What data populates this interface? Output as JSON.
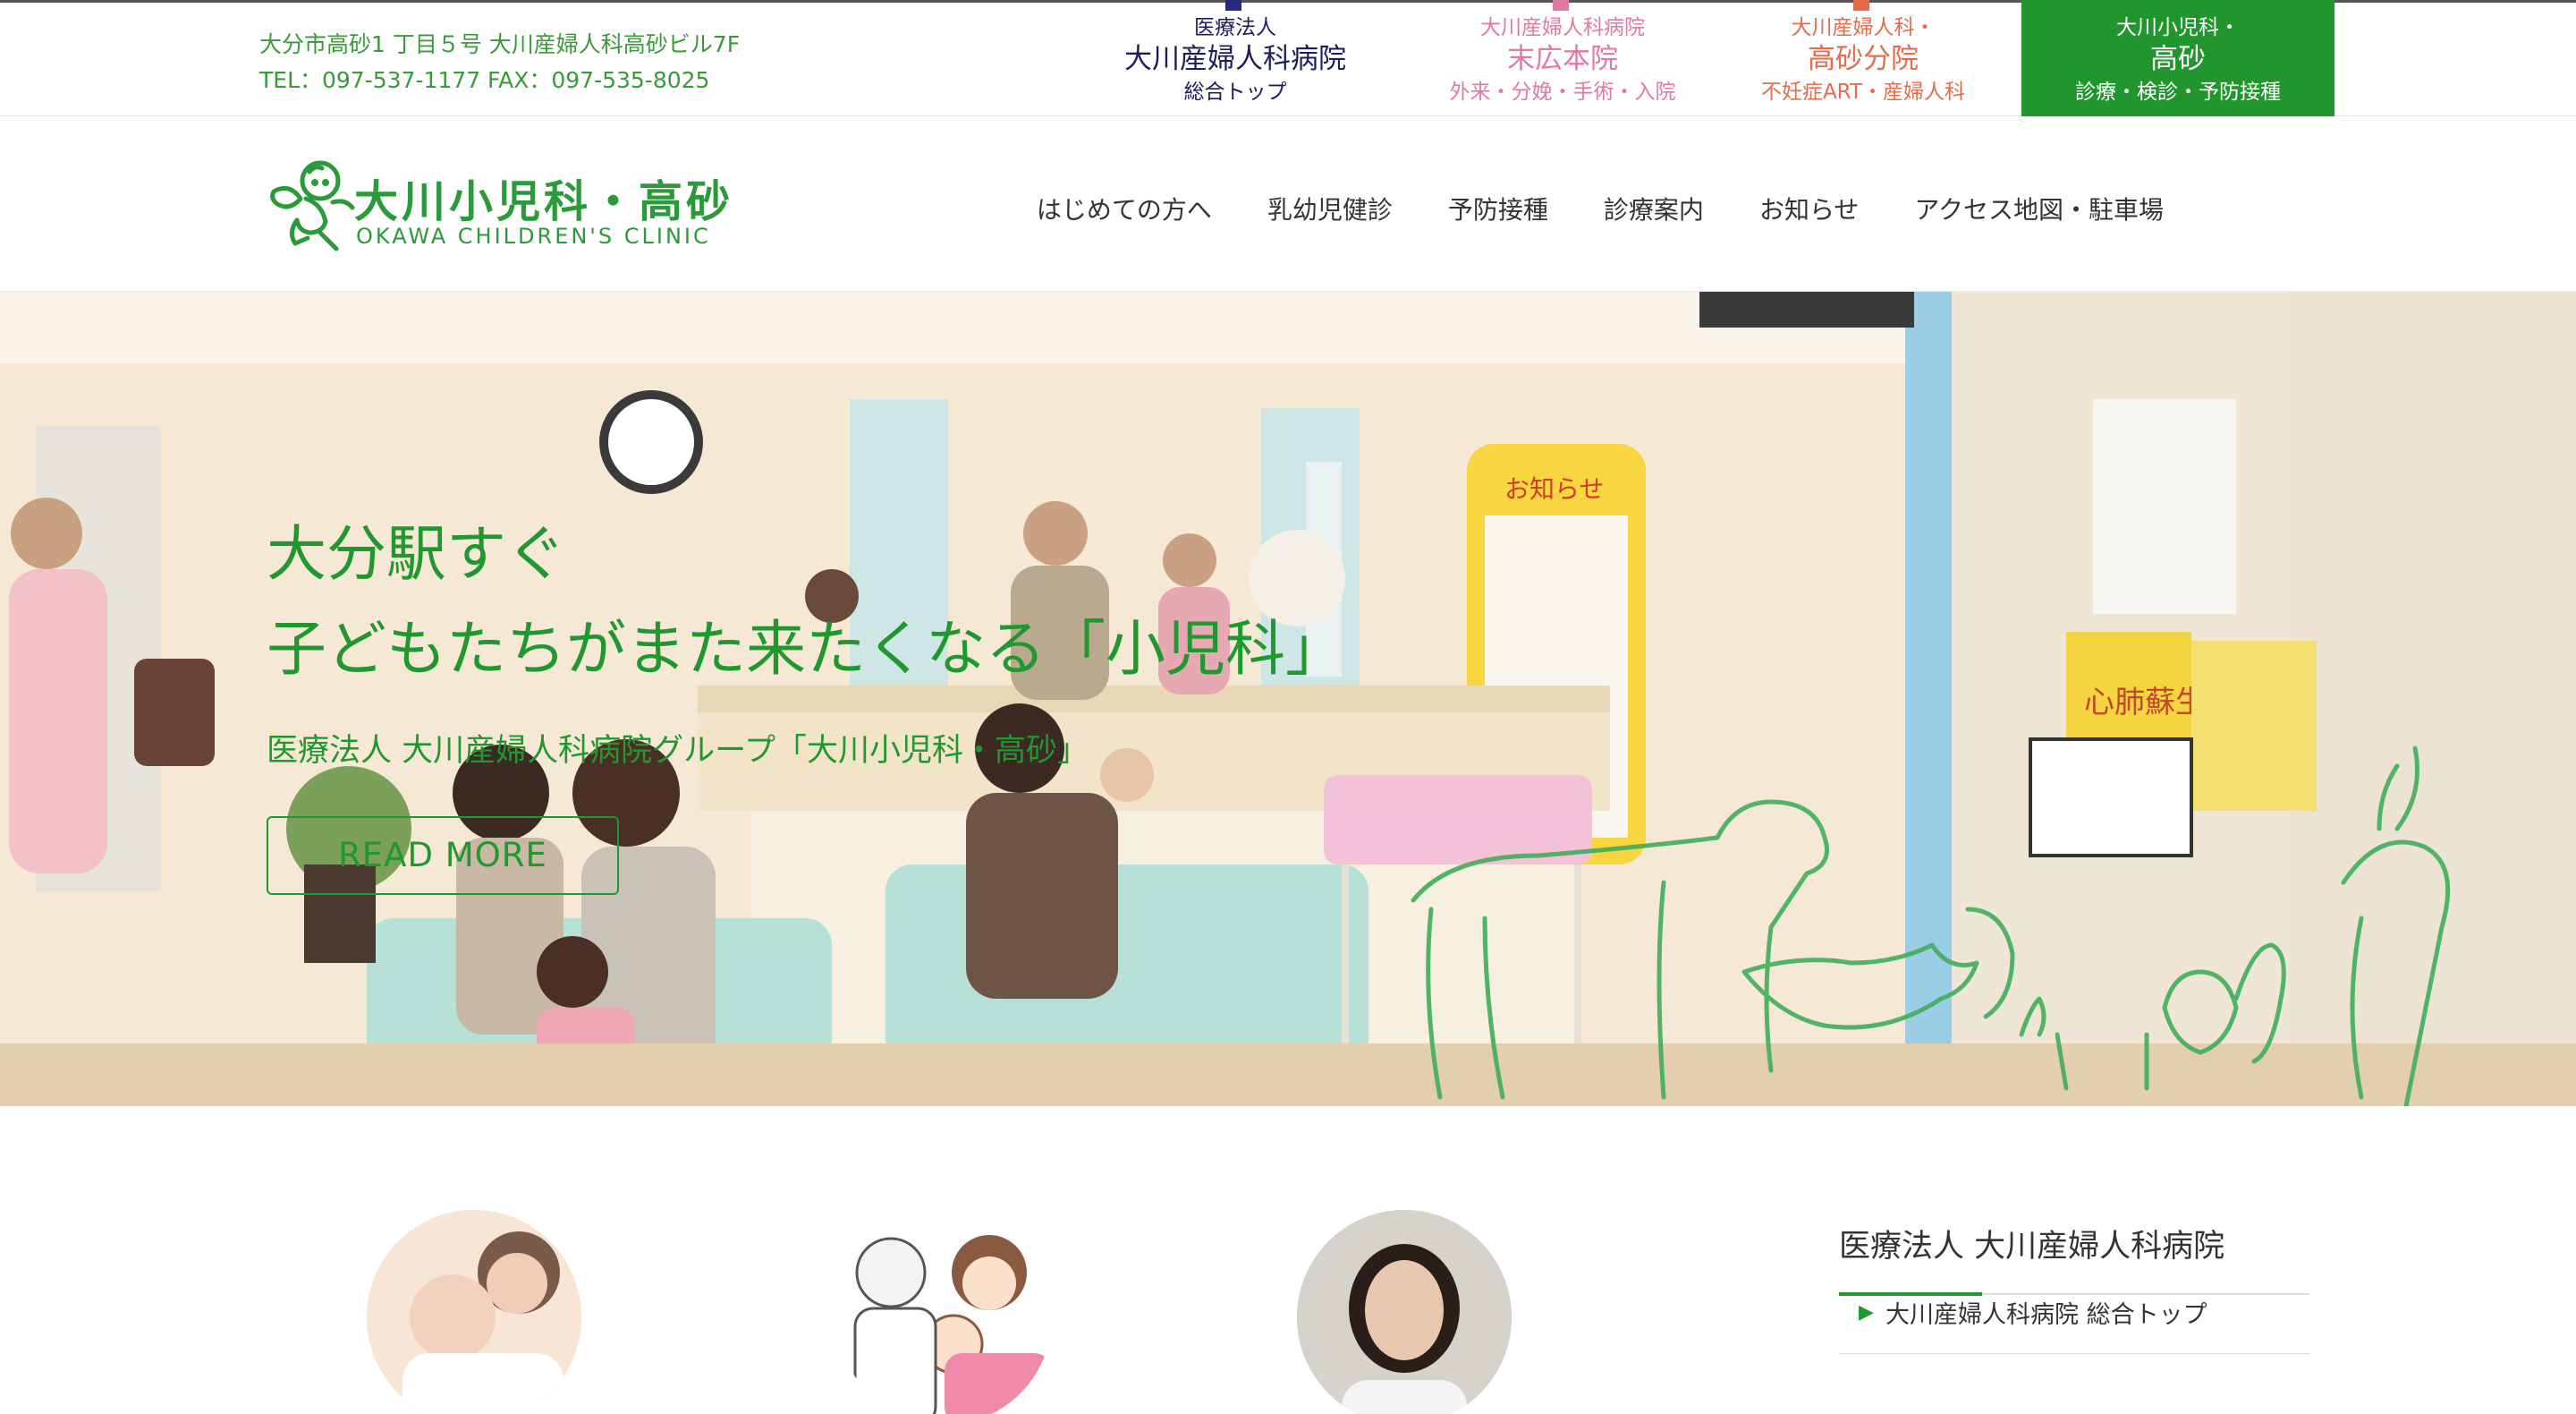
{
  "topbar": {
    "address": "大分市高砂1 丁目５号 大川産婦人科高砂ビル7F",
    "tel": "TEL：097-537-1177 FAX：097-535-8025",
    "tabs": [
      {
        "small": "医療法人",
        "big": "大川産婦人科病院",
        "sub": "総合トップ"
      },
      {
        "small": "大川産婦人科病院",
        "big": "末広本院",
        "sub": "外来・分娩・手術・入院"
      },
      {
        "small": "大川産婦人科・",
        "big": "高砂分院",
        "sub": "不妊症ART・産婦人科"
      },
      {
        "small": "大川小児科・",
        "big": "高砂",
        "sub": "診療・検診・予防接種"
      }
    ]
  },
  "logo": {
    "jp": "大川小児科・高砂",
    "en": "OKAWA CHILDREN'S  CLINIC"
  },
  "nav": [
    "はじめての方へ",
    "乳幼児健診",
    "予防接種",
    "診療案内",
    "お知らせ",
    "アクセス地図・駐車場"
  ],
  "hero": {
    "line1": "大分駅すぐ",
    "line2": "子どもたちがまた来たくなる「小児科」",
    "sub": "医療法人 大川産婦人科病院グループ「大川小児科・高砂」",
    "button": "READ MORE",
    "board_label": "お知らせ",
    "poster_text": "心肺蘇生"
  },
  "sidebar": {
    "title": "医療法人 大川産婦人科病院",
    "item": "大川産婦人科病院 総合トップ"
  },
  "colors": {
    "brand_green": "#22962e",
    "navy": "#1c1c5e",
    "pink": "#e07aa5",
    "orange": "#e56c4a"
  }
}
